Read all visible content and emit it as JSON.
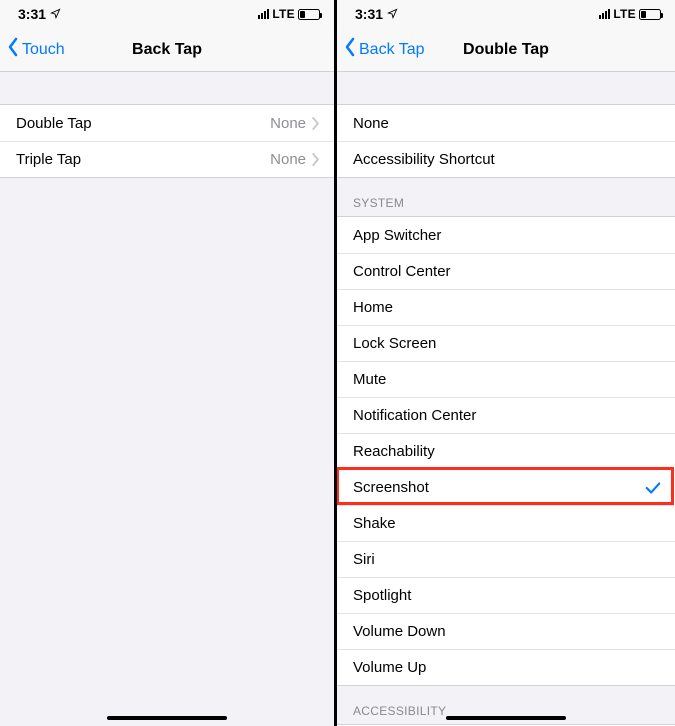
{
  "status": {
    "time": "3:31",
    "network": "LTE"
  },
  "left": {
    "back_label": "Touch",
    "title": "Back Tap",
    "rows": [
      {
        "label": "Double Tap",
        "value": "None"
      },
      {
        "label": "Triple Tap",
        "value": "None"
      }
    ]
  },
  "right": {
    "back_label": "Back Tap",
    "title": "Double Tap",
    "top_rows": [
      {
        "label": "None"
      },
      {
        "label": "Accessibility Shortcut"
      }
    ],
    "system_header": "SYSTEM",
    "system_rows": [
      {
        "label": "App Switcher"
      },
      {
        "label": "Control Center"
      },
      {
        "label": "Home"
      },
      {
        "label": "Lock Screen"
      },
      {
        "label": "Mute"
      },
      {
        "label": "Notification Center"
      },
      {
        "label": "Reachability"
      },
      {
        "label": "Screenshot",
        "selected": true,
        "highlight": true
      },
      {
        "label": "Shake"
      },
      {
        "label": "Siri"
      },
      {
        "label": "Spotlight"
      },
      {
        "label": "Volume Down"
      },
      {
        "label": "Volume Up"
      }
    ],
    "accessibility_header": "ACCESSIBILITY"
  }
}
